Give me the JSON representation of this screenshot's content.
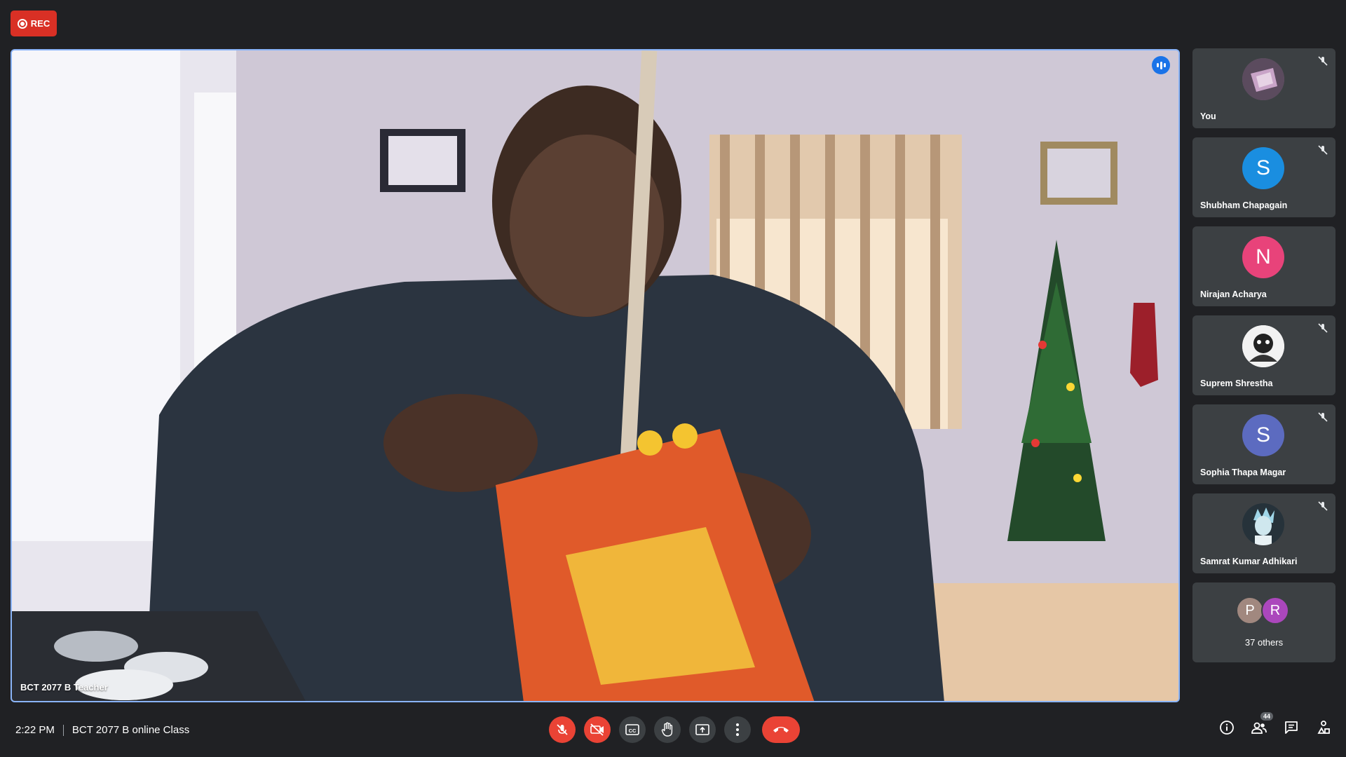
{
  "recording": {
    "label": "REC",
    "color": "#d93025"
  },
  "main_video": {
    "participant_name": "BCT 2077 B Teacher",
    "speaking_icon": "speaking-indicator-icon"
  },
  "participants": [
    {
      "name": "You",
      "avatar": "image",
      "muted": true
    },
    {
      "name": "Shubham Chapagain",
      "initial": "S",
      "avatar_color": "#1a8ee0",
      "muted": true
    },
    {
      "name": "Nirajan Acharya",
      "initial": "N",
      "avatar_color": "#e8437a",
      "muted": false
    },
    {
      "name": "Suprem Shrestha",
      "avatar": "image",
      "muted": true
    },
    {
      "name": "Sophia Thapa Magar",
      "initial": "S",
      "avatar_color": "#5c6bc0",
      "muted": true
    },
    {
      "name": "Samrat Kumar Adhikari",
      "avatar": "image",
      "muted": true
    }
  ],
  "others": {
    "label": "37 others",
    "initials": [
      "P",
      "R"
    ],
    "colors": [
      "#a1887f",
      "#ab47bc"
    ]
  },
  "meeting": {
    "time": "2:22 PM",
    "title": "BCT 2077 B online Class"
  },
  "controls": {
    "mic": "mic-off-icon",
    "camera": "camera-off-icon",
    "captions": "captions-icon",
    "raise_hand": "raise-hand-icon",
    "present": "present-screen-icon",
    "more": "more-options-icon",
    "hangup": "hang-up-icon"
  },
  "right_controls": {
    "people_count": "44"
  }
}
